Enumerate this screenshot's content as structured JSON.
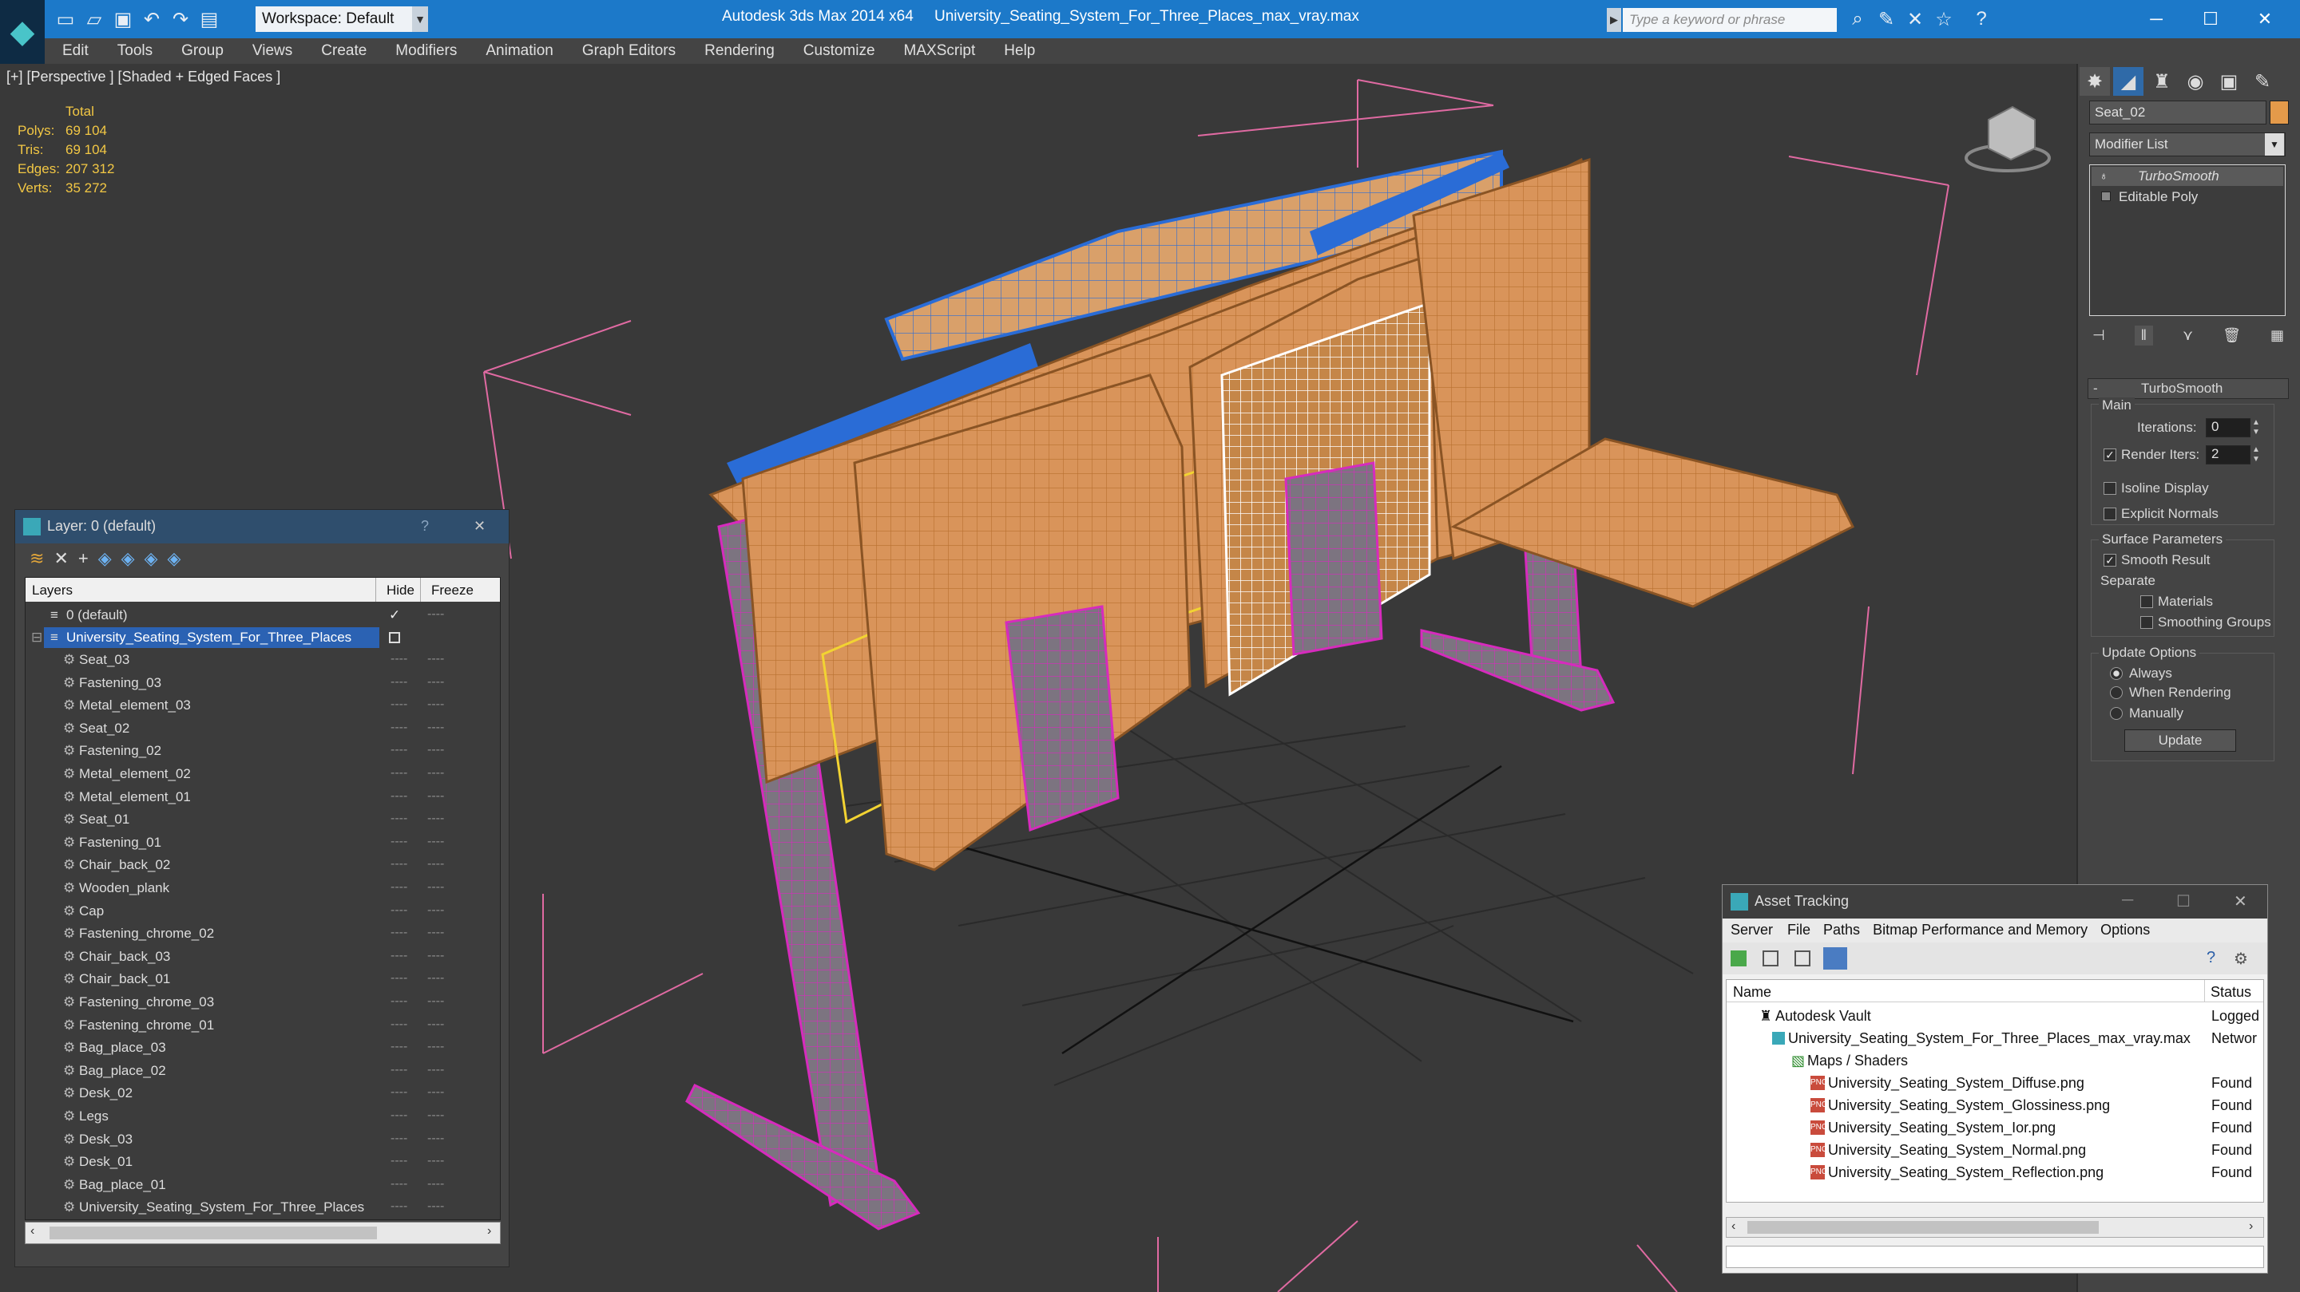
{
  "app": {
    "title": "Autodesk 3ds Max  2014 x64",
    "file_title": "University_Seating_System_For_Three_Places_max_vray.max",
    "workspace": "Workspace: Default",
    "search_placeholder": "Type a keyword or phrase",
    "window_controls": {
      "minimize": "─",
      "maximize": "☐",
      "close": "✕"
    }
  },
  "menu": [
    "Edit",
    "Tools",
    "Group",
    "Views",
    "Create",
    "Modifiers",
    "Animation",
    "Graph Editors",
    "Rendering",
    "Customize",
    "MAXScript",
    "Help"
  ],
  "viewport": {
    "label": "[+] [Perspective ] [Shaded + Edged Faces ]",
    "stats": {
      "header": "Total",
      "rows": [
        {
          "label": "Polys:",
          "value": "69 104"
        },
        {
          "label": "Tris:",
          "value": "69 104"
        },
        {
          "label": "Edges:",
          "value": "207 312"
        },
        {
          "label": "Verts:",
          "value": "35 272"
        }
      ]
    }
  },
  "command_panel": {
    "object_name": "Seat_02",
    "modifier_list": "Modifier List",
    "stack": [
      "TurboSmooth",
      "Editable Poly"
    ],
    "rollout_title": "TurboSmooth",
    "main_label": "Main",
    "iterations_label": "Iterations:",
    "iterations_value": "0",
    "render_iters_label": "Render Iters:",
    "render_iters_value": "2",
    "isoline_display": "Isoline Display",
    "explicit_normals": "Explicit Normals",
    "surface_params_label": "Surface Parameters",
    "smooth_result": "Smooth Result",
    "separate_label": "Separate",
    "materials": "Materials",
    "smoothing_groups": "Smoothing Groups",
    "update_options_label": "Update Options",
    "always": "Always",
    "when_rendering": "When Rendering",
    "manually": "Manually",
    "update_button": "Update"
  },
  "layer_panel": {
    "title": "Layer: 0 (default)",
    "help": "?",
    "close": "✕",
    "col_layers": "Layers",
    "col_hide": "Hide",
    "col_freeze": "Freeze",
    "layers": [
      "0 (default)",
      "University_Seating_System_For_Three_Places"
    ],
    "objects": [
      "Seat_03",
      "Fastening_03",
      "Metal_element_03",
      "Seat_02",
      "Fastening_02",
      "Metal_element_02",
      "Metal_element_01",
      "Seat_01",
      "Fastening_01",
      "Chair_back_02",
      "Wooden_plank",
      "Cap",
      "Fastening_chrome_02",
      "Chair_back_03",
      "Chair_back_01",
      "Fastening_chrome_03",
      "Fastening_chrome_01",
      "Bag_place_03",
      "Bag_place_02",
      "Desk_02",
      "Legs",
      "Desk_03",
      "Desk_01",
      "Bag_place_01",
      "University_Seating_System_For_Three_Places"
    ],
    "dash": "----"
  },
  "asset_panel": {
    "title": "Asset Tracking",
    "menu": [
      "Server",
      "File",
      "Paths",
      "Bitmap Performance and Memory",
      "Options"
    ],
    "col_name": "Name",
    "col_status": "Status",
    "rows": [
      {
        "name": "Autodesk Vault",
        "status": "Logged"
      },
      {
        "name": "University_Seating_System_For_Three_Places_max_vray.max",
        "status": "Networ"
      },
      {
        "name": "Maps / Shaders",
        "status": ""
      },
      {
        "name": "University_Seating_System_Diffuse.png",
        "status": "Found"
      },
      {
        "name": "University_Seating_System_Glossiness.png",
        "status": "Found"
      },
      {
        "name": "University_Seating_System_Ior.png",
        "status": "Found"
      },
      {
        "name": "University_Seating_System_Normal.png",
        "status": "Found"
      },
      {
        "name": "University_Seating_System_Reflection.png",
        "status": "Found"
      }
    ]
  },
  "colors": {
    "titlebar": "#1c79c9",
    "wood": "#d9945a",
    "wire_magenta": "#e02bc0",
    "wire_blue": "#2a6cd6",
    "stats": "#f2c744",
    "selection": "#2b62b3"
  }
}
